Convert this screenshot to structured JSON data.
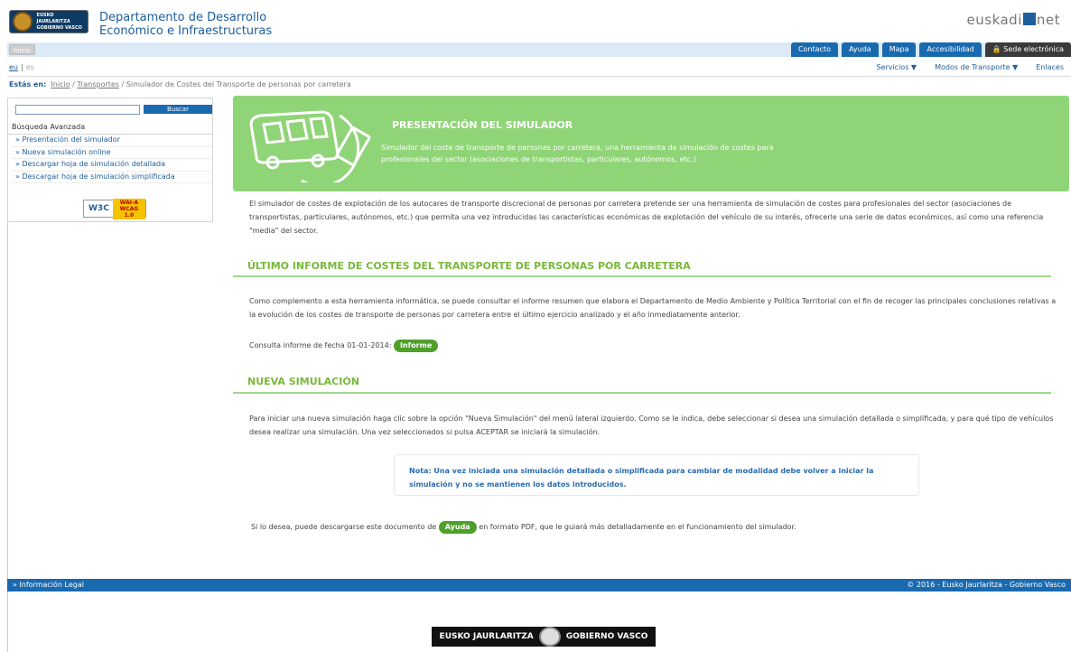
{
  "header": {
    "logo_text": "EUSKO JAURLARITZA\nGOBIERNO VASCO",
    "dept_line1": "Departamento de Desarrollo",
    "dept_line2": "Económico e Infraestructuras",
    "brand_a": "euskadi",
    "brand_b": "net"
  },
  "topnav": {
    "inicio": "Inicio",
    "links": [
      "Contacto",
      "Ayuda",
      "Mapa",
      "Accesibilidad"
    ],
    "sede": "Sede electrónica"
  },
  "lang": {
    "eu": "eu",
    "sep": "|",
    "es": "es"
  },
  "menu2": [
    "Servicios ▼",
    "Modos de Transporte ▼",
    "Enlaces"
  ],
  "breadcrumb": {
    "label": "Estás en:",
    "inicio": "Inicio",
    "sep": " / ",
    "transportes": "Transportes",
    "current": "Simulador de Costes del Transporte de personas por carretera"
  },
  "sidebar": {
    "search_value": "",
    "buscar": "Buscar",
    "busqueda_avanzada": "Búsqueda Avanzada",
    "items": [
      "» Presentación del simulador",
      "» Nueva simulación online",
      "» Descargar hoja de simulación detallada",
      "» Descargar hoja de simulación simplificada"
    ],
    "w3c": "W3C",
    "wai_line1": "WAI-A",
    "wai_line2": "WCAG 1.0"
  },
  "banner": {
    "title": "PRESENTACIÓN DEL SIMULADOR",
    "subtitle": "Simulador del coste de transporte de personas por carretera, una herramienta de simulación de costes para profesionales del sector (asociaciones de transportistas, particulares, autónomos, etc.)"
  },
  "intro": "El simulador de costes de explotación de los autocares de transporte discrecional de personas por carretera pretende ser una herramienta de simulación de costes para profesionales del sector (asociaciones de transportistas, particulares, autónomos, etc.) que permita una vez introducidas las características económicas de explotación del vehículo de su interés, ofrecerle una serie de datos económicos, así como una referencia \"media\" del sector.",
  "section1": {
    "title": "ÚLTIMO INFORME DE COSTES DEL TRANSPORTE DE PERSONAS POR CARRETERA",
    "text": "Como complemento a esta herramienta informática, se puede consultar el informe resumen que elabora el Departamento de Medio Ambiente y Política Territorial con el fin de recoger las principales conclusiones relativas a la evolución de los costes de transporte de personas por carretera entre el último ejercicio analizado y el año inmediatamente anterior.",
    "consulta": "Consulta informe de fecha 01-01-2014:",
    "informe_btn": "Informe"
  },
  "section2": {
    "title": "NUEVA SIMULACIÓN",
    "text": "Para iniciar una nueva simulación haga clic sobre la opción \"Nueva Simulación\" del menú lateral izquierdo. Como se le indica, debe seleccionar si desea una simulación detallada o simplificada, y para qué tipo de vehículos desea realizar una simulación. Una vez seleccionados si pulsa ACEPTAR se iniciará la simulación.",
    "note": "Nota: Una vez iniciada una simulación detallada o simplificada para cambiar de modalidad debe volver a iniciar la simulación y no se mantienen los datos introducidos.",
    "help_pre": "Si lo desea, puede descargarse este documento de",
    "ayuda_btn": "Ayuda",
    "help_post": "en formato PDF, que le guiará más detalladamente en el funcionamiento del simulador."
  },
  "footer": {
    "legal": "» Información Legal",
    "copyright": "© 2016 - Eusko Jaurlaritza - Gobierno Vasco",
    "logo_left": "EUSKO JAURLARITZA",
    "logo_right": "GOBIERNO VASCO"
  },
  "colors": {
    "accent_blue": "#1a6ab0",
    "green": "#90d478",
    "dark_green": "#4ea02a"
  }
}
